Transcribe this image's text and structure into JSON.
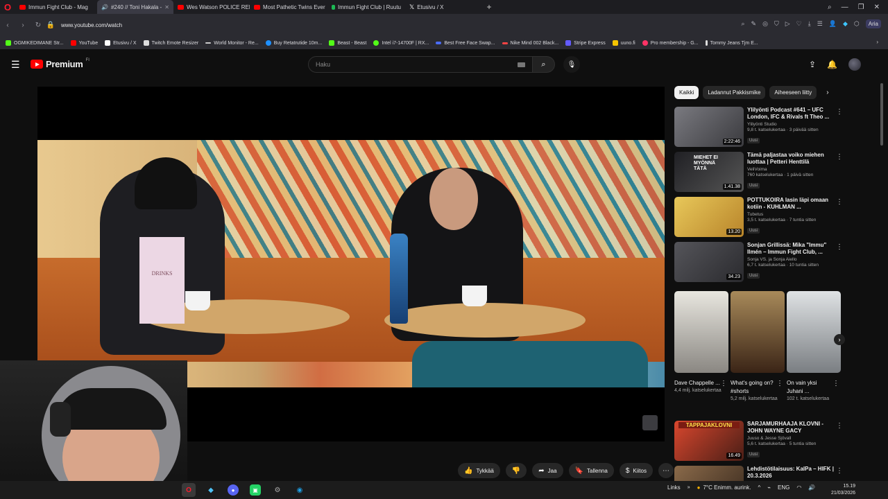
{
  "browser": {
    "tabs": [
      {
        "title": "Immun Fight Club - Mag",
        "favicon_color": "#ff0000"
      },
      {
        "title": "#240 // Toni Hakala -",
        "favicon_color": "#ff0000",
        "active": true
      },
      {
        "title": "Wes Watson POLICE REPO",
        "favicon_color": "#ff0000"
      },
      {
        "title": "Most Pathetic Twins Ever",
        "favicon_color": "#ff0000"
      },
      {
        "title": "Immun Fight Club | Ruutu",
        "favicon_color": "#1db954"
      },
      {
        "title": "Etusivu / X",
        "favicon_color": "#ffffff"
      }
    ],
    "url": "www.youtube.com/watch",
    "aria_label": "Aria",
    "bookmarks": [
      {
        "label": "OGMIKEDIMANE Str...",
        "color": "#53fc18"
      },
      {
        "label": "YouTube",
        "color": "#ff0000"
      },
      {
        "label": "Etusivu / X",
        "color": "#ffffff"
      },
      {
        "label": "Twitch Emote Resizer",
        "color": "#dddddd"
      },
      {
        "label": "World Monitor - Re...",
        "color": "#cccccc"
      },
      {
        "label": "Buy Retatrutide 10m...",
        "color": "#1e90ff"
      },
      {
        "label": "Beast - Beast",
        "color": "#53fc18"
      },
      {
        "label": "Intel i7-14700F | RX...",
        "color": "#53fc18"
      },
      {
        "label": "Best Free Face Swap...",
        "color": "#4a6cf7"
      },
      {
        "label": "Nike Mind 002 Black...",
        "color": "#ff4444"
      },
      {
        "label": "Stripe Express",
        "color": "#635bff"
      },
      {
        "label": "uuno.fi",
        "color": "#f5c400"
      },
      {
        "label": "Pro membership - G...",
        "color": "#ff3366"
      },
      {
        "label": "Tommy Jeans Tjm E...",
        "color": "#dddddd"
      }
    ]
  },
  "youtube": {
    "logo_text": "Premium",
    "region": "FI",
    "search_placeholder": "Haku",
    "player": {
      "menu_card_text": "DRINKS"
    },
    "actions": [
      {
        "label": "Tykkää",
        "icon": "thumbs-up-icon"
      },
      {
        "label": "",
        "icon": "thumbs-down-icon"
      },
      {
        "label": "Jaa",
        "icon": "share-icon"
      },
      {
        "label": "Tallenna",
        "icon": "bookmark-icon"
      },
      {
        "label": "Kiitos",
        "icon": "thanks-icon"
      },
      {
        "label": "",
        "icon": "more-icon"
      }
    ],
    "chips": [
      {
        "label": "Kaikki",
        "selected": true
      },
      {
        "label": "Ladannut Pakkismike"
      },
      {
        "label": "Aiheeseen liitty"
      }
    ],
    "recommendations": [
      {
        "title": "Ylilyönti Podcast #641 – UFC London, IFC & Rivals ft Theo ...",
        "channel": "Ylilyönti Studio",
        "stats": "9,8 t. katselukertaa · 3 päivää sitten",
        "badge": "Uusi",
        "duration": "2:22:46",
        "color": "#5a5a5e"
      },
      {
        "title": "Tämä paljastaa voiko miehen luottaa | Petteri Henttilä",
        "channel": "VeliVoima",
        "stats": "760 katselukertaa · 1 päivä sitten",
        "badge": "Uusi",
        "duration": "1.41.38",
        "color": "#2a2a2e"
      },
      {
        "title": "POTTUKOIRA lasin läpi omaan kotiin - KUHLMAN ...",
        "channel": "Tubetus",
        "stats": "3,5 t. katselukertaa · 7 tuntia sitten",
        "badge": "Uusi",
        "duration": "13.20",
        "color": "#d8b44a"
      },
      {
        "title": "Sonjan Grillissä: Mika \"Immu\" Ilmén – Immun Fight Club, ...",
        "channel": "Sonja VS. ja Sonja Aiello",
        "stats": "6,7 t. katselukertaa · 10 tuntia sitten",
        "badge": "Uusi",
        "duration": "34.23",
        "color": "#3e3e44"
      },
      {
        "title": "SARJAMURHAAJA KLOVNI - JOHN WAYNE GACY",
        "channel": "Juuso & Jesse Sjövall",
        "stats": "5,6 t. katselukertaa · 5 tuntia sitten",
        "badge": "Uusi",
        "duration": "16.49",
        "color": "#c43a2c"
      },
      {
        "title": "Lehdistötilaisuus: KalPa – HIFK | 20.3.2026",
        "channel": "",
        "stats": "",
        "badge": "",
        "duration": "",
        "color": "#6a4a3a"
      }
    ],
    "rec_thumb_texts": [
      "MIEHET EI MYÖNNÄ TÄTÄ",
      "TAPPAJAKLOVNI"
    ],
    "shorts": [
      {
        "title": "Dave Chappelle ...",
        "views": "4,4 milj. katselukertaa",
        "color": "#d8d6cf"
      },
      {
        "title": "What's going on? #shorts",
        "views": "5,2 milj. katselukertaa",
        "color": "#5a3a22"
      },
      {
        "title": "On vain yksi Juhani ...",
        "views": "102 t. katselukertaa",
        "color": "#b0b4b8"
      }
    ]
  },
  "taskbar": {
    "links_label": "Links",
    "weather": "7°C  Enimm. aurink.",
    "language": "ENG",
    "time": "15.19",
    "date": "21/03/2026"
  }
}
